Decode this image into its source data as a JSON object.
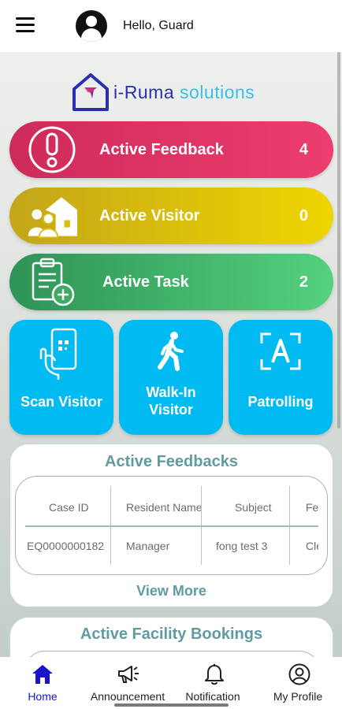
{
  "header": {
    "greeting": "Hello, Guard"
  },
  "brand": {
    "name_main": "i-Ruma",
    "name_sub": "solutions"
  },
  "stats": [
    {
      "label": "Active Feedback",
      "count": "4",
      "icon": "exclamation-circle-icon"
    },
    {
      "label": "Active Visitor",
      "count": "0",
      "icon": "visitors-house-icon"
    },
    {
      "label": "Active Task",
      "count": "2",
      "icon": "clipboard-add-icon"
    }
  ],
  "tiles": [
    {
      "label": "Scan Visitor",
      "icon": "qr-phone-icon"
    },
    {
      "label": "Walk-In Visitor",
      "line1": "Walk-In",
      "line2": "Visitor",
      "icon": "walking-person-icon"
    },
    {
      "label": "Patrolling",
      "icon": "scan-frame-icon"
    }
  ],
  "feedbacks_panel": {
    "title": "Active Feedbacks",
    "columns": [
      "Case ID",
      "Resident Name",
      "Subject",
      "Feedback"
    ],
    "rows": [
      [
        "EQ0000000182",
        "Manager",
        "fong test 3",
        "Clea"
      ]
    ],
    "view_more": "View More"
  },
  "bookings_panel": {
    "title": "Active Facility Bookings"
  },
  "bottom_nav": [
    {
      "label": "Home",
      "icon": "home-icon",
      "active": true
    },
    {
      "label": "Announcement",
      "icon": "megaphone-icon",
      "active": false
    },
    {
      "label": "Notification",
      "icon": "bell-icon",
      "active": false
    },
    {
      "label": "My Profile",
      "icon": "profile-icon",
      "active": false
    }
  ],
  "colors": {
    "feedback": "#e0355f",
    "visitor": "#e6c80a",
    "task": "#3fb36a",
    "tile": "#00bbf2",
    "nav_active": "#1a14c9",
    "panel_title": "#5f9ba0"
  }
}
